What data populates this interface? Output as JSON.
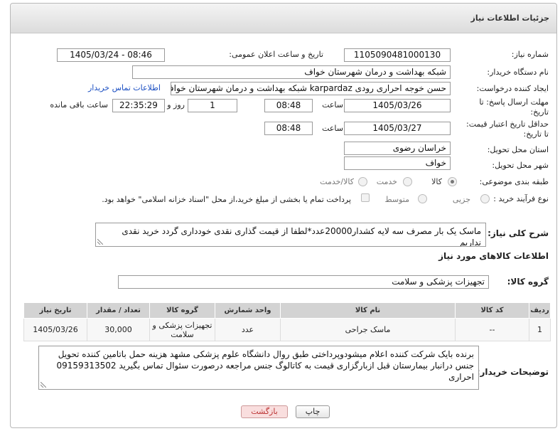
{
  "page": {
    "title": "جزئیات اطلاعات نیاز"
  },
  "form": {
    "need_number_label": "شماره نیاز:",
    "need_number": "1105090481000130",
    "announce_label": "تاریخ و ساعت اعلان عمومی:",
    "announce_value": "1405/03/24 - 08:46",
    "buyer_label": "نام دستگاه خریدار:",
    "buyer_value": "شبکه بهداشت و درمان شهرستان خواف",
    "creator_label": "ایجاد کننده درخواست:",
    "creator_value": "حسن خوجه احراری رودی karpardaz شبکه بهداشت و درمان شهرستان خواف",
    "contact_link": "اطلاعات تماس خریدار",
    "deadline_label_1": "مهلت ارسال پاسخ: تا",
    "deadline_label_2": "تاریخ:",
    "deadline_date": "1405/03/26",
    "time_label": "ساعت",
    "deadline_time": "08:48",
    "days_value": "1",
    "days_label": "روز و",
    "remaining_value": "22:35:29",
    "remaining_label": "ساعت باقی مانده",
    "validity_label_1": "حداقل تاریخ اعتبار قیمت:",
    "validity_label_2": "تا تاریخ:",
    "validity_date": "1405/03/27",
    "validity_time": "08:48",
    "province_label": "استان محل تحویل:",
    "province_value": "خراسان رضوی",
    "city_label": "شهر محل تحویل:",
    "city_value": "خواف",
    "category_label": "طبقه بندی موضوعی:",
    "category_options": [
      "کالا",
      "خدمت",
      "کالا/خدمت"
    ],
    "process_label": "نوع فرآیند خرید :",
    "process_options": [
      "جزیی",
      "متوسط"
    ],
    "payment_text": "پرداخت تمام یا بخشی از مبلغ خرید،از محل \"اسناد خزانه اسلامی\" خواهد بود.",
    "description_label": "شرح کلی نیاز:",
    "description_value": "ماسک یک بار مصرف سه لایه  کشدار20000عدد*لطفا از قیمت گذاری نقدی خودداری گردد خرید نقدی نداریم"
  },
  "goods": {
    "section_title": "اطلاعات کالاهای مورد نیاز",
    "group_label": "گروه کالا:",
    "group_value": "تجهیزات پزشکی و سلامت",
    "columns": [
      "ردیف",
      "کد کالا",
      "نام کالا",
      "واحد شمارش",
      "گروه کالا",
      "تعداد / مقدار",
      "تاریخ نیاز"
    ],
    "rows": [
      {
        "row": "1",
        "code": "--",
        "name": "ماسک جراحی",
        "unit": "عدد",
        "group": "تجهیزات پزشکی و سلامت",
        "qty": "30,000",
        "date": "1405/03/26"
      }
    ]
  },
  "buyer_notes": {
    "label": "توضیحات خریدار:",
    "text": "برنده بایک شرکت کننده اعلام میشودوپرداختی طبق روال دانشگاه علوم پزشکی مشهد هزینه حمل باتامین کننده تحویل جنس درانبار بیمارستان قبل ازبارگزاری قیمت به کاتالوگ جنس مراجعه درصورت سئوال تماس بگیرید 09159313502 احراری"
  },
  "buttons": {
    "print": "چاپ",
    "back": "بازگشت"
  },
  "colors": {
    "link": "#1a4ec2",
    "back_button_bg": "#f9dede",
    "table_header_bg": "#d3d3d3"
  }
}
